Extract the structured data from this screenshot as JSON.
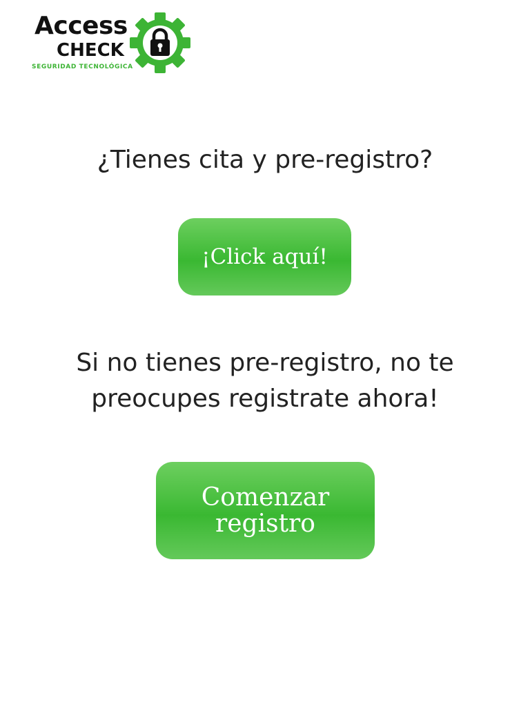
{
  "logo": {
    "word1": "Access",
    "word2": "CHECK",
    "tagline": "SEGURIDAD TECNOLÓGICA",
    "icon": "gear-lock-icon",
    "brand_color": "#3db435"
  },
  "question": "¿Tienes cita y pre-registro?",
  "click_button_label": "¡Click aquí!",
  "info_text": "Si no tienes pre-registro, no te preocupes registrate ahora!",
  "start_button_label": "Comenzar registro",
  "colors": {
    "button_green": "#3ab832",
    "button_green_light": "#6dcf5f",
    "text_dark": "#222222"
  }
}
